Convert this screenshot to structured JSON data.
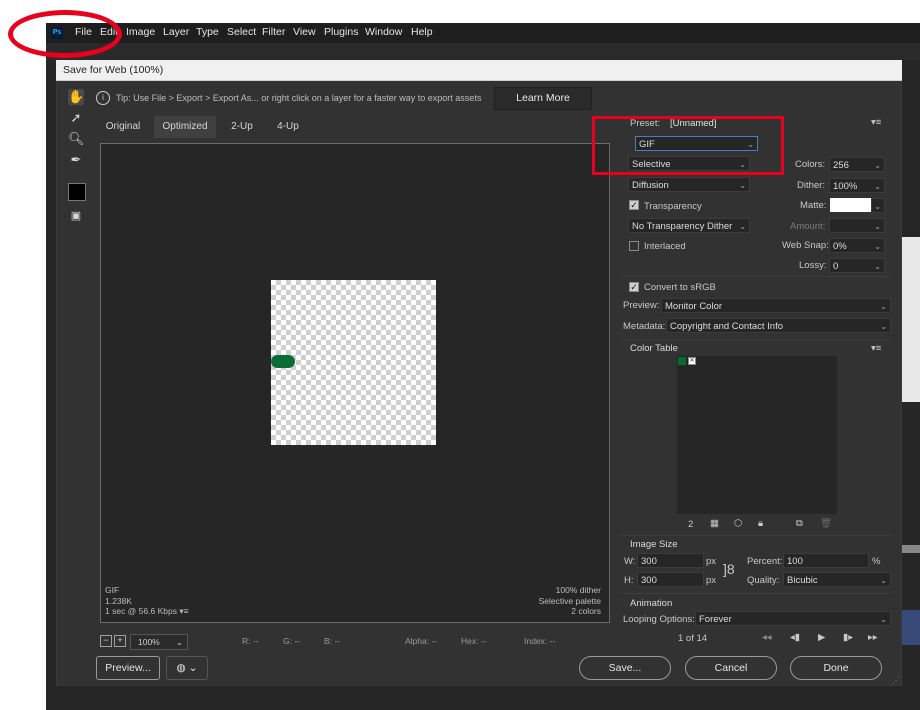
{
  "app": {
    "logo": "Ps",
    "menu": [
      "File",
      "Edit",
      "Image",
      "Layer",
      "Type",
      "Select",
      "Filter",
      "View",
      "Plugins",
      "Window",
      "Help"
    ]
  },
  "dialog": {
    "title": "Save for Web (100%)",
    "tip": "Tip: Use File > Export > Export As...  or right click on a layer for a faster way to export assets",
    "learn_more": "Learn More",
    "tabs": [
      "Original",
      "Optimized",
      "2-Up",
      "4-Up"
    ],
    "active_tab": "Optimized",
    "preview_info_left": [
      "GIF",
      "1.238K",
      "1 sec @ 56.6 Kbps"
    ],
    "preview_info_right": [
      "100% dither",
      "Selective palette",
      "2 colors"
    ],
    "zoom": "100%",
    "readouts": {
      "r": "R: --",
      "g": "G: --",
      "b": "B: --",
      "alpha": "Alpha: --",
      "hex": "Hex: --",
      "index": "Index: --"
    },
    "buttons": {
      "preview": "Preview...",
      "save": "Save...",
      "cancel": "Cancel",
      "done": "Done"
    }
  },
  "settings": {
    "preset_label": "Preset:",
    "preset_value": "[Unnamed]",
    "format": "GIF",
    "reduction": "Selective",
    "colors_label": "Colors:",
    "colors": "256",
    "dither_algo": "Diffusion",
    "dither_label": "Dither:",
    "dither": "100%",
    "transparency_label": "Transparency",
    "transparency": true,
    "matte_label": "Matte:",
    "transparency_dither": "No Transparency Dither",
    "amount_label": "Amount:",
    "interlaced_label": "Interlaced",
    "interlaced": false,
    "web_snap_label": "Web Snap:",
    "web_snap": "0%",
    "lossy_label": "Lossy:",
    "lossy": "0",
    "convert_srgb_label": "Convert to sRGB",
    "convert_srgb": true,
    "preview_label": "Preview:",
    "preview_value": "Monitor Color",
    "metadata_label": "Metadata:",
    "metadata_value": "Copyright and Contact Info",
    "color_table_title": "Color Table",
    "color_count": "2",
    "swatch_color": "#0b6b35",
    "image_size_title": "Image Size",
    "width_label": "W:",
    "width": "300",
    "height_label": "H:",
    "height": "300",
    "px": "px",
    "percent_label": "Percent:",
    "percent": "100",
    "percent_unit": "%",
    "quality_label": "Quality:",
    "quality": "Bicubic",
    "animation_title": "Animation",
    "looping_label": "Looping Options:",
    "looping": "Forever",
    "frame_counter": "1 of 14"
  }
}
